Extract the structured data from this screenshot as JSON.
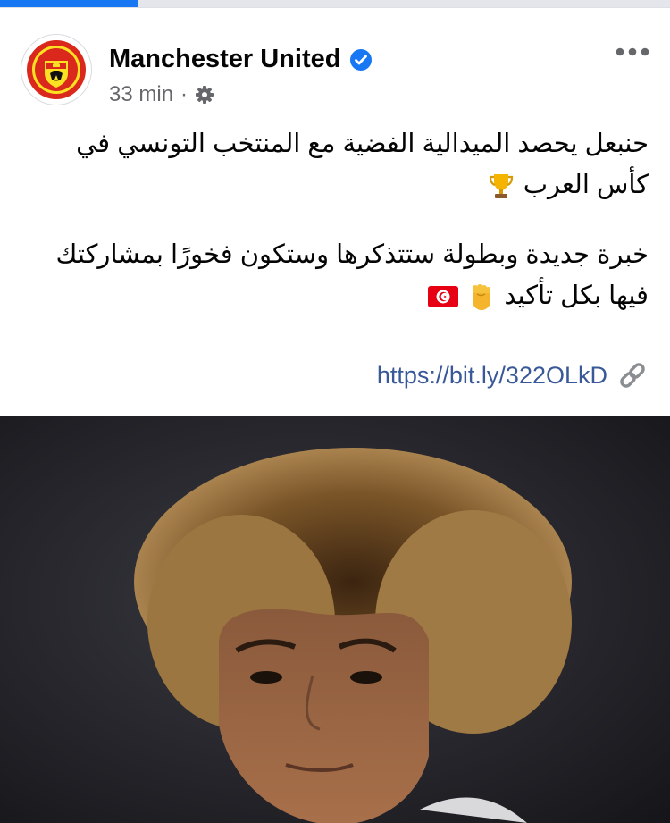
{
  "load_progress": 0.205,
  "post": {
    "page_name": "Manchester United",
    "verified": true,
    "time": "33 min",
    "audience_icon": "settings-gear-icon",
    "paragraph1": "حنبعل يحصد الميدالية الفضية مع المنتخب التونسي في كأس العرب",
    "paragraph2": "خبرة جديدة وبطولة ستتذكرها وستكون فخورًا بمشاركتك فيها بكل تأكيد",
    "link": "https://bit.ly/322OLkD",
    "emojis": [
      "trophy",
      "raised-fist",
      "tunisia-flag",
      "link"
    ]
  },
  "colors": {
    "brand_red": "#da291c",
    "verified_blue": "#1877f2",
    "link_blue": "#385898",
    "meta_gray": "#65676b"
  }
}
